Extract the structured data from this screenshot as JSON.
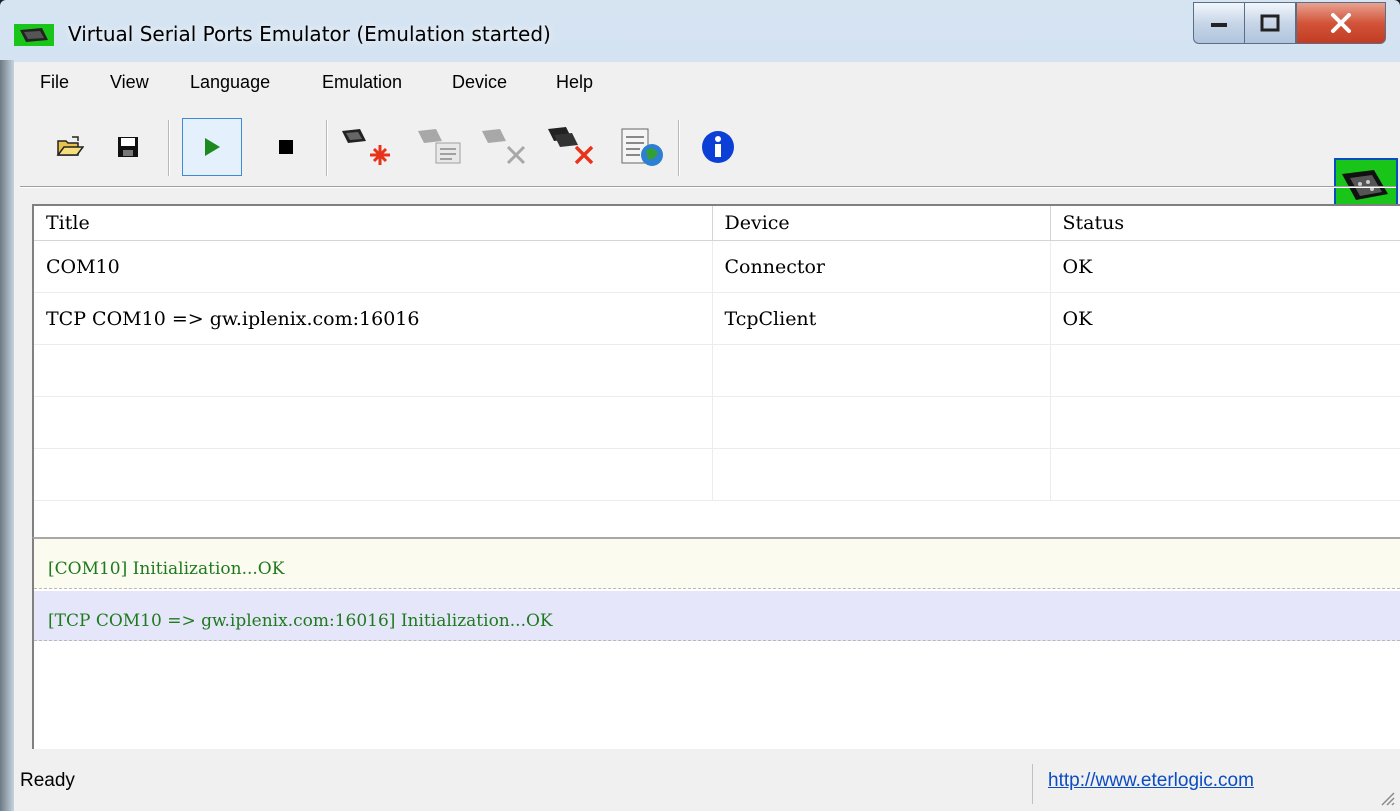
{
  "window": {
    "title": "Virtual Serial Ports Emulator (Emulation started)",
    "buttons": {
      "minimize": "minimize",
      "maximize": "maximize",
      "close": "close"
    }
  },
  "menu": {
    "items": [
      "File",
      "View",
      "Language",
      "Emulation",
      "Device",
      "Help"
    ]
  },
  "toolbar": {
    "buttons": [
      {
        "name": "open-icon"
      },
      {
        "name": "save-icon"
      },
      {
        "name": "start-icon",
        "active": true
      },
      {
        "name": "stop-icon"
      },
      {
        "name": "new-device-icon"
      },
      {
        "name": "edit-device-icon",
        "disabled": true
      },
      {
        "name": "delete-device-icon",
        "disabled": true
      },
      {
        "name": "delete-all-devices-icon"
      },
      {
        "name": "configuration-icon"
      },
      {
        "name": "info-icon"
      }
    ]
  },
  "grid": {
    "columns": [
      "Title",
      "Device",
      "Status"
    ],
    "rows": [
      [
        "COM10",
        "Connector",
        "OK"
      ],
      [
        "TCP COM10 => gw.iplenix.com:16016",
        "TcpClient",
        "OK"
      ],
      [
        "",
        "",
        ""
      ],
      [
        "",
        "",
        ""
      ],
      [
        "",
        "",
        ""
      ]
    ]
  },
  "log": {
    "entries": [
      {
        "text": "[COM10] Initialization...OK",
        "bg": "#fbfbf0"
      },
      {
        "text": "[TCP COM10 => gw.iplenix.com:16016] Initialization...OK",
        "bg": "#e6e6fa"
      }
    ],
    "text_color": "#1f7a1f"
  },
  "statusbar": {
    "text": "Ready",
    "link": "http://www.eterlogic.com"
  },
  "colors": {
    "accent": "#0b4cc2",
    "logo_bg": "#19c519",
    "close_btn": "#c8462e"
  }
}
